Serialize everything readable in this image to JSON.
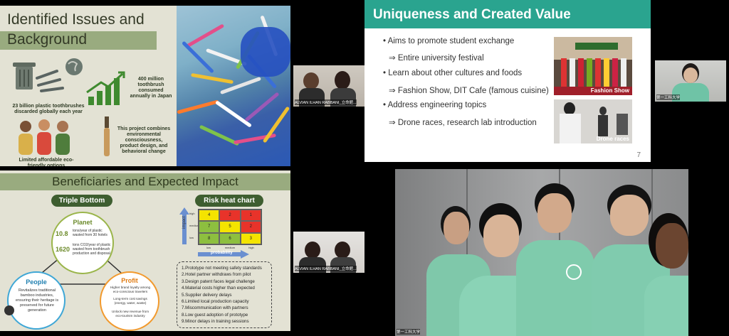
{
  "slide1": {
    "title_line1": "Identified Issues and",
    "title_line2": "Background",
    "stat1": "23 billion plastic toothbrushes discarded globally each year",
    "stat2": "400 million toothbrush consumed annually in Japan",
    "stat3": "Limited affordable eco-friendly options",
    "stat4": "This project combines environmental consciousness, product design, and behavioral change"
  },
  "slide2": {
    "title": "Beneficiaries and Expected Impact",
    "triple_bottom": "Triple Bottom",
    "risk_heat_chart": "Risk heat chart",
    "planet": {
      "label": "Planet",
      "val1": "10.8",
      "desc1": "tons/year of plastic wasted from 30 hotels",
      "val2": "1620",
      "desc2": "tons CO2/year of plastic wasted from toothbrush production and disposal"
    },
    "people": {
      "label": "People",
      "desc": "Revitalizes traditional bamboo industries, ensuring their heritage is preserved for future generation"
    },
    "profit": {
      "label": "Profit",
      "items": [
        "Higher brand loyalty among eco-conscious travelers",
        "Long-term cost savings (energy, water, waste)",
        "Unlock new revenue from eco-tourism industry"
      ]
    },
    "heat": {
      "ylabel": "impact",
      "xlabel": "probability",
      "yticks": [
        "high",
        "medium",
        "low"
      ],
      "xticks": [
        "low",
        "medium",
        "high"
      ],
      "cells": [
        [
          "4",
          "2",
          "1"
        ],
        [
          "7",
          "5",
          "2"
        ],
        [
          "8",
          "6",
          "3"
        ]
      ],
      "colors": [
        [
          "#f4e400",
          "#e8332a",
          "#e8332a"
        ],
        [
          "#8dbf3f",
          "#f4e400",
          "#e8332a"
        ],
        [
          "#8dbf3f",
          "#8dbf3f",
          "#f4e400"
        ]
      ]
    },
    "risks": [
      "1.Prototype not meeting safety standards",
      "2.Hotel partner withdraws from pilot",
      "3.Design patent faces legal challenge",
      "4.Material costs higher than expected",
      "5.Supplier delivery delays",
      "6.Limited local production capacity",
      "7.Miscommunication with partners",
      "8.Low guest adoption of prototype",
      "9.Minor delays in training sessions"
    ]
  },
  "video_tiles": {
    "tile1_name": "ALVIAN ILHAN RABBANI_立命館...",
    "tile2_name": "ALVIAN ILHAN RABBANI_立命館...",
    "tile3_name": "第一工科大学",
    "tile4_name": "第一工科大学"
  },
  "slide3": {
    "title": "Uniqueness and Created Value",
    "bullets": [
      "• Aims to promote student exchange",
      "⇒ Entire university festival",
      "• Learn about other cultures and foods",
      "⇒ Fashion Show, DIT Cafe (famous cuisine)",
      "• Address engineering topics",
      "⇒ Drone races, research lab introduction"
    ],
    "photo1_caption": "Fashion Show",
    "photo2_caption": "Drone races",
    "page_number": "7"
  },
  "colors": {
    "olive_band": "#99ab7f",
    "teal_header": "#2aa48f",
    "dark_green_pill": "#3e5e30"
  }
}
